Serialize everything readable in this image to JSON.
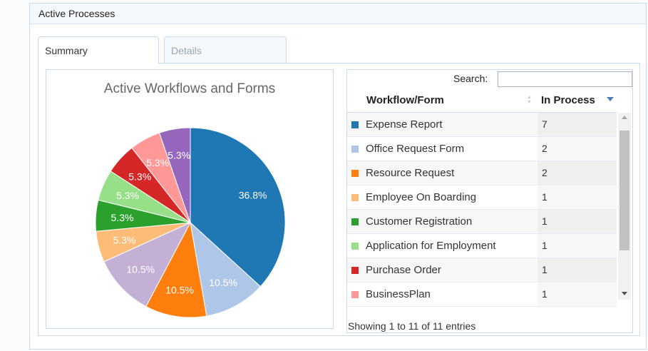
{
  "panel": {
    "title": "Active Processes"
  },
  "tabs": [
    {
      "label": "Summary",
      "active": true
    },
    {
      "label": "Details",
      "active": false
    }
  ],
  "table": {
    "search_label": "Search:",
    "search_value": "",
    "columns": [
      "Workflow/Form",
      "In Process"
    ],
    "rows": [
      {
        "name": "Expense Report",
        "value": "7",
        "color": "#1f77b4"
      },
      {
        "name": "Office Request Form",
        "value": "2",
        "color": "#aec7e8"
      },
      {
        "name": "Resource Request",
        "value": "2",
        "color": "#ff7f0e"
      },
      {
        "name": "Employee On Boarding",
        "value": "1",
        "color": "#ffbb78"
      },
      {
        "name": "Customer Registration",
        "value": "1",
        "color": "#2ca02c"
      },
      {
        "name": "Application for Employment",
        "value": "1",
        "color": "#98df8a"
      },
      {
        "name": "Purchase Order",
        "value": "1",
        "color": "#d62728"
      },
      {
        "name": "BusinessPlan",
        "value": "1",
        "color": "#ff9896"
      }
    ],
    "info": "Showing 1 to 11 of 11 entries"
  },
  "chart_data": {
    "type": "pie",
    "title": "Active Workflows and Forms",
    "slices": [
      {
        "value": 36.8,
        "label": "36.8%",
        "color": "#1f77b4"
      },
      {
        "value": 10.5,
        "label": "10.5%",
        "color": "#aec7e8"
      },
      {
        "value": 10.5,
        "label": "10.5%",
        "color": "#ff7f0e"
      },
      {
        "value": 10.5,
        "label": "10.5%",
        "color": "#c5b0d5"
      },
      {
        "value": 5.3,
        "label": "5.3%",
        "color": "#ffbb78"
      },
      {
        "value": 5.3,
        "label": "5.3%",
        "color": "#2ca02c"
      },
      {
        "value": 5.3,
        "label": "5.3%",
        "color": "#98df8a"
      },
      {
        "value": 5.3,
        "label": "5.3%",
        "color": "#d62728"
      },
      {
        "value": 5.3,
        "label": "5.3%",
        "color": "#ff9896"
      },
      {
        "value": 5.3,
        "label": "5.3%",
        "color": "#9467bd"
      }
    ]
  }
}
